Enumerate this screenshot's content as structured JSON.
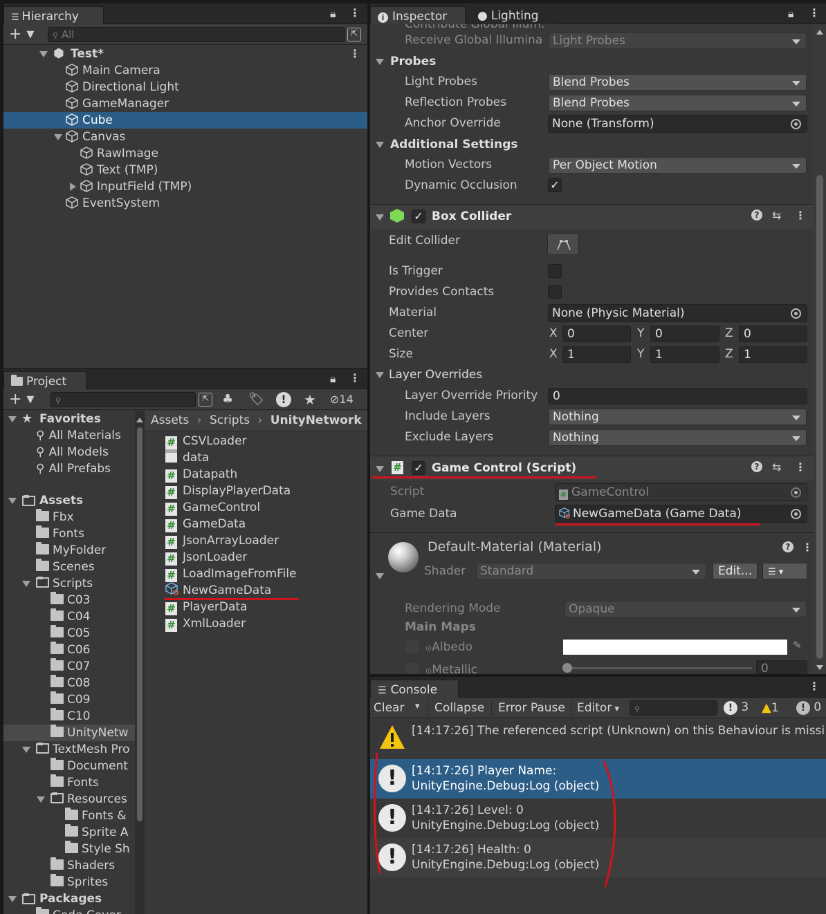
{
  "hierarchy": {
    "tab_label": "Hierarchy",
    "search_placeholder": "All",
    "scene_name": "Test*",
    "items": [
      {
        "label": "Main Camera"
      },
      {
        "label": "Directional Light"
      },
      {
        "label": "GameManager"
      },
      {
        "label": "Cube",
        "selected": true
      },
      {
        "label": "Canvas"
      },
      {
        "label": "RawImage"
      },
      {
        "label": "Text (TMP)"
      },
      {
        "label": "InputField (TMP)"
      },
      {
        "label": "EventSystem"
      }
    ]
  },
  "project": {
    "tab_label": "Project",
    "hidden_count": "14",
    "favorites": {
      "label": "Favorites",
      "items": [
        "All Materials",
        "All Models",
        "All Prefabs"
      ]
    },
    "assets_label": "Assets",
    "tree": [
      "Fbx",
      "Fonts",
      "MyFolder",
      "Scenes",
      "Scripts",
      "C03",
      "C04",
      "C05",
      "C06",
      "C07",
      "C08",
      "C09",
      "C10",
      "UnityNetw",
      "TextMesh Pro",
      "Document",
      "Fonts",
      "Resources",
      "Fonts &",
      "Sprite A",
      "Style Sh",
      "Shaders",
      "Sprites"
    ],
    "packages_label": "Packages",
    "packages_partial": "Code Cover",
    "breadcrumb": [
      "Assets",
      "Scripts",
      "UnityNetwork"
    ],
    "files": [
      {
        "label": "CSVLoader",
        "kind": "script"
      },
      {
        "label": "data",
        "kind": "text"
      },
      {
        "label": "Datapath",
        "kind": "script"
      },
      {
        "label": "DisplayPlayerData",
        "kind": "script"
      },
      {
        "label": "GameControl",
        "kind": "script"
      },
      {
        "label": "GameData",
        "kind": "script"
      },
      {
        "label": "JsonArrayLoader",
        "kind": "script"
      },
      {
        "label": "JsonLoader",
        "kind": "script"
      },
      {
        "label": "LoadImageFromFile",
        "kind": "script"
      },
      {
        "label": "NewGameData",
        "kind": "scriptable"
      },
      {
        "label": "PlayerData",
        "kind": "script"
      },
      {
        "label": "XmlLoader",
        "kind": "script"
      }
    ]
  },
  "inspector": {
    "tab_inspector": "Inspector",
    "tab_lighting": "Lighting",
    "partial_top": "Contribute Global Illum.",
    "receive_gi_label": "Receive Global Illumina",
    "receive_gi_value": "Light Probes",
    "probes_header": "Probes",
    "light_probes_label": "Light Probes",
    "light_probes_value": "Blend Probes",
    "reflection_probes_label": "Reflection Probes",
    "reflection_probes_value": "Blend Probes",
    "anchor_override_label": "Anchor Override",
    "anchor_override_value": "None (Transform)",
    "additional_header": "Additional Settings",
    "motion_vectors_label": "Motion Vectors",
    "motion_vectors_value": "Per Object Motion",
    "dynamic_occlusion_label": "Dynamic Occlusion",
    "box_collider": {
      "title": "Box Collider",
      "edit_collider": "Edit Collider",
      "is_trigger": "Is Trigger",
      "provides_contacts": "Provides Contacts",
      "material_label": "Material",
      "material_value": "None (Physic Material)",
      "center_label": "Center",
      "size_label": "Size",
      "axis_x": "X",
      "axis_y": "Y",
      "axis_z": "Z",
      "center": [
        "0",
        "0",
        "0"
      ],
      "size": [
        "1",
        "1",
        "1"
      ],
      "layer_overrides": "Layer Overrides",
      "priority_label": "Layer Override Priority",
      "priority_value": "0",
      "include_label": "Include Layers",
      "include_value": "Nothing",
      "exclude_label": "Exclude Layers",
      "exclude_value": "Nothing"
    },
    "game_control": {
      "title": "Game Control (Script)",
      "script_label": "Script",
      "script_value": "GameControl",
      "game_data_label": "Game Data",
      "game_data_value": "NewGameData (Game Data)"
    },
    "material": {
      "title": "Default-Material (Material)",
      "shader_label": "Shader",
      "shader_value": "Standard",
      "edit_button": "Edit...",
      "rendering_mode_label": "Rendering Mode",
      "rendering_mode_value": "Opaque",
      "main_maps": "Main Maps",
      "albedo": "Albedo",
      "metallic": "Metallic",
      "metallic_value": "0"
    }
  },
  "console": {
    "tab_label": "Console",
    "clear": "Clear",
    "collapse": "Collapse",
    "error_pause": "Error Pause",
    "editor": "Editor",
    "count_log": "3",
    "count_warn": "1",
    "count_error": "0",
    "messages": [
      {
        "type": "warning",
        "line1": "[14:17:26] The referenced script (Unknown) on this Behaviour is missi",
        "line2": ""
      },
      {
        "type": "log",
        "line1": "[14:17:26] Player Name:",
        "line2": "UnityEngine.Debug:Log (object)",
        "selected": true
      },
      {
        "type": "log",
        "line1": "[14:17:26] Level: 0",
        "line2": "UnityEngine.Debug:Log (object)"
      },
      {
        "type": "log",
        "line1": "[14:17:26] Health: 0",
        "line2": "UnityEngine.Debug:Log (object)"
      }
    ]
  },
  "colors": {
    "selection": "#2c5d87",
    "annotation_red": "#d0141b",
    "script_green": "#2f8a2f",
    "warning_yellow": "#f1c40f"
  }
}
